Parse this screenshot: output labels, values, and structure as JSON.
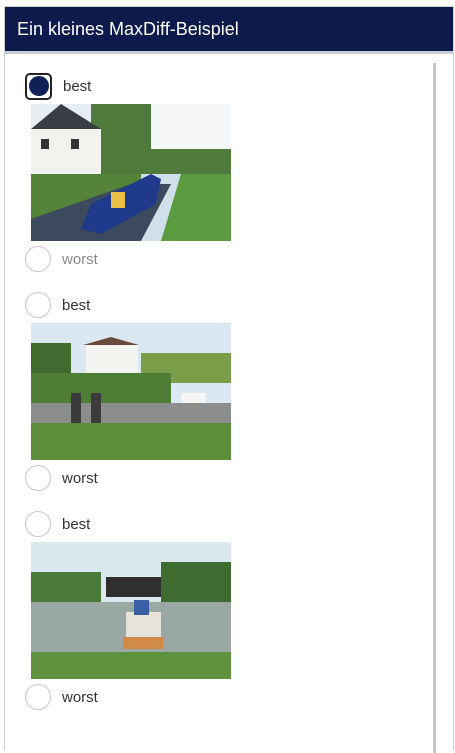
{
  "header": {
    "title": "Ein kleines MaxDiff-Beispiel"
  },
  "colors": {
    "header_bg": "#0d1b4c",
    "selected_radio": "#0f2156"
  },
  "items": [
    {
      "best_label": "best",
      "worst_label": "worst",
      "best_selected": true,
      "image": "canal-narrowboat-cottage"
    },
    {
      "best_label": "best",
      "worst_label": "worst",
      "best_selected": false,
      "image": "canal-lock-gates-house"
    },
    {
      "best_label": "best",
      "worst_label": "worst",
      "best_selected": false,
      "image": "canal-boat-entering-lock"
    }
  ]
}
